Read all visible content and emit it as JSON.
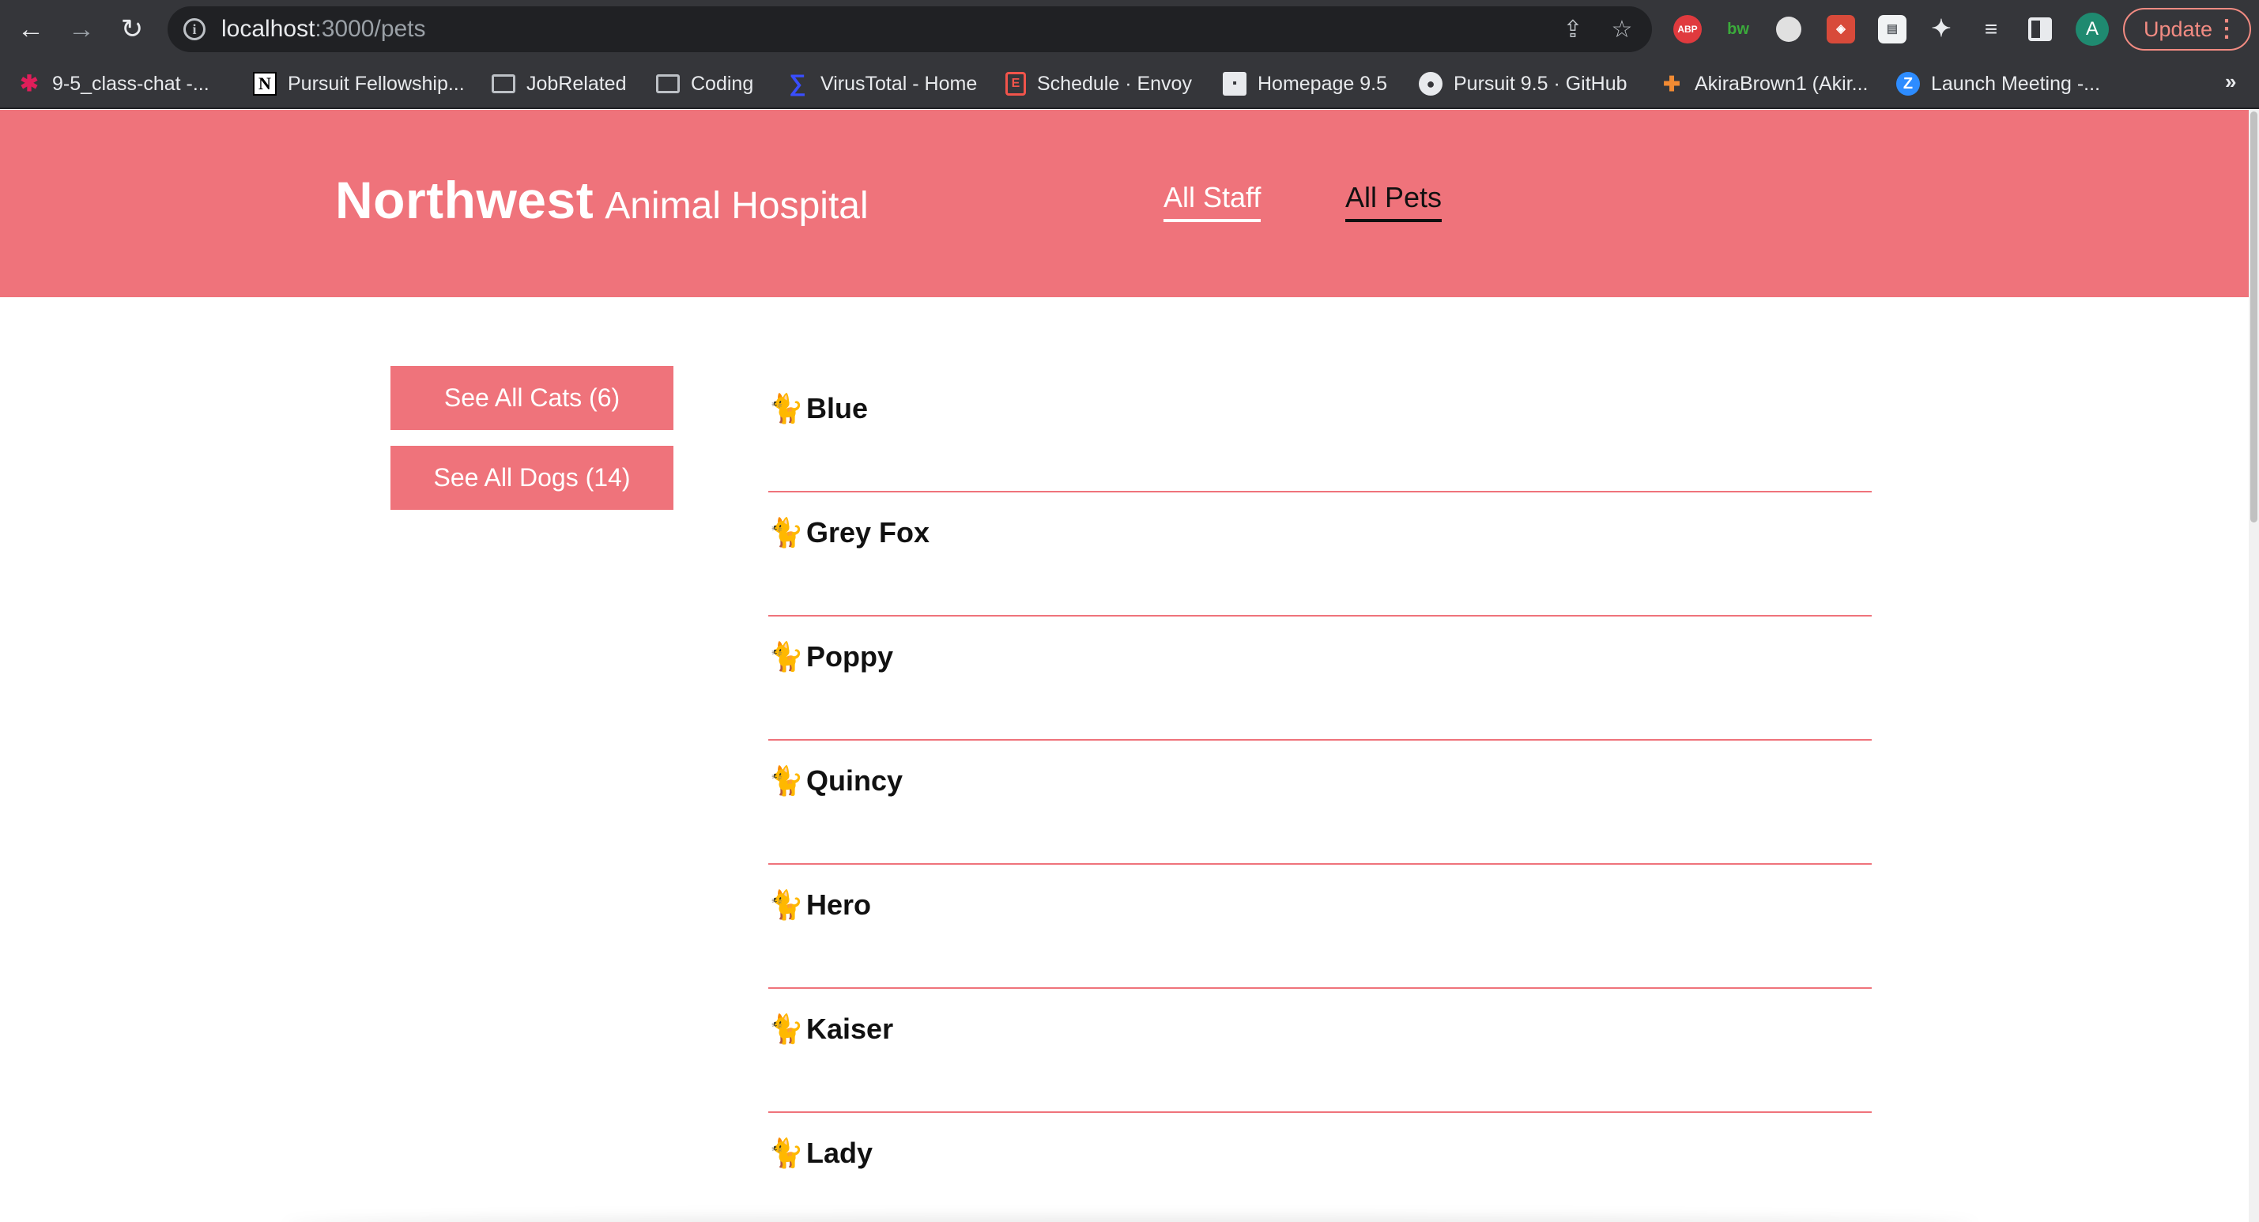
{
  "browser": {
    "url_host": "localhost",
    "url_path": ":3000/pets",
    "update_label": "Update",
    "avatar_letter": "A",
    "extensions": {
      "abp": "ABP",
      "bw": "bw"
    },
    "bookmarks": [
      {
        "label": "9-5_class-chat -...",
        "icon": "slack-icon"
      },
      {
        "label": "Pursuit Fellowship...",
        "icon": "notion-icon"
      },
      {
        "label": "JobRelated",
        "icon": "folder-icon"
      },
      {
        "label": "Coding",
        "icon": "folder-icon"
      },
      {
        "label": "VirusTotal - Home",
        "icon": "virustotal-icon"
      },
      {
        "label": "Schedule · Envoy",
        "icon": "envoy-icon"
      },
      {
        "label": "Homepage 9.5",
        "icon": "floppy-icon"
      },
      {
        "label": "Pursuit 9.5 · GitHub",
        "icon": "github-icon"
      },
      {
        "label": "AkiraBrown1 (Akir...",
        "icon": "akira-icon"
      },
      {
        "label": "Launch Meeting -...",
        "icon": "zoom-icon"
      }
    ],
    "more": "»"
  },
  "site": {
    "brand_main": "Northwest",
    "brand_sub": "Animal Hospital",
    "nav": {
      "staff": "All Staff",
      "pets": "All Pets"
    },
    "accent_color": "#ef737b"
  },
  "filters": {
    "cats": "See All Cats (6)",
    "dogs": "See All Dogs (14)"
  },
  "pets": [
    {
      "glyph": "🐈",
      "name": "Blue"
    },
    {
      "glyph": "🐈",
      "name": "Grey Fox"
    },
    {
      "glyph": "🐈",
      "name": "Poppy"
    },
    {
      "glyph": "🐈",
      "name": "Quincy"
    },
    {
      "glyph": "🐈",
      "name": "Hero"
    },
    {
      "glyph": "🐈",
      "name": "Kaiser"
    },
    {
      "glyph": "🐈",
      "name": "Lady"
    }
  ]
}
